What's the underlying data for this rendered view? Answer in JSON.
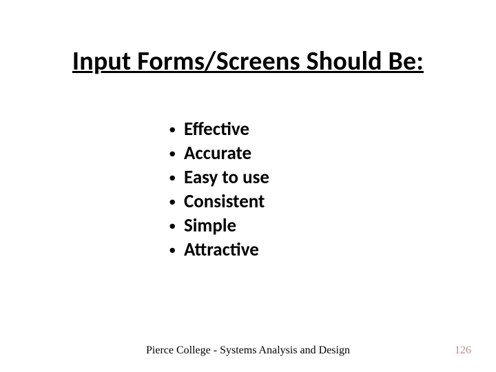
{
  "title": "Input Forms/Screens Should Be:",
  "bullets": [
    "Effective",
    "Accurate",
    "Easy to use",
    "Consistent",
    "Simple",
    "Attractive"
  ],
  "footer": "Pierce College - Systems Analysis and Design",
  "page_number": "126"
}
